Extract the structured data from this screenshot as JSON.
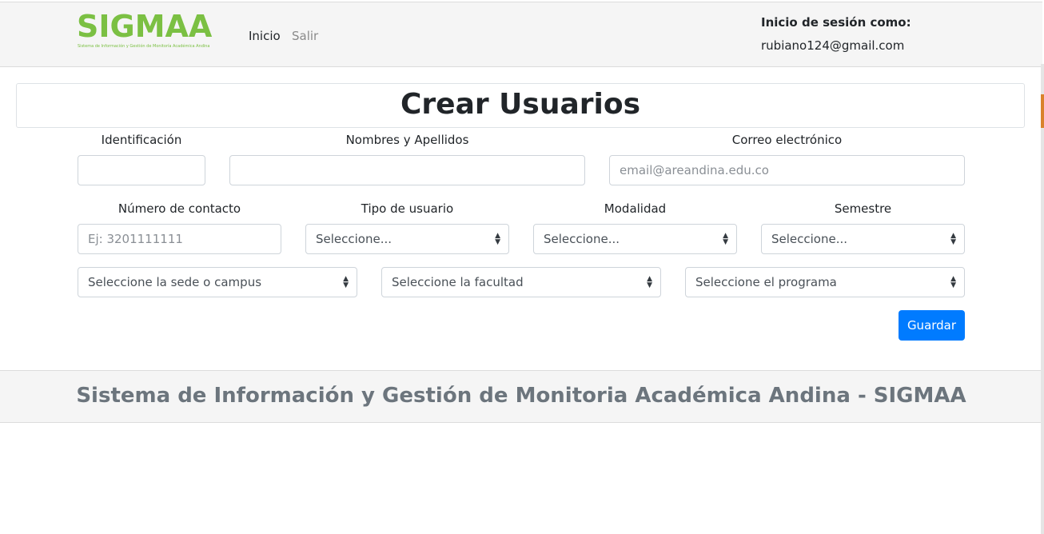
{
  "header": {
    "logo_text": "SIGMAA",
    "logo_tagline": "Sistema de Información y Gestión de Monitoría Académica Andina",
    "nav": {
      "inicio": "Inicio",
      "salir": "Salir"
    },
    "session_label": "Inicio de sesión como:",
    "session_email": "rubiano124@gmail.com"
  },
  "page": {
    "title": "Crear Usuarios"
  },
  "form": {
    "identificacion": {
      "label": "Identificación",
      "value": "",
      "placeholder": ""
    },
    "nombres": {
      "label": "Nombres y Apellidos",
      "value": "",
      "placeholder": ""
    },
    "correo": {
      "label": "Correo electrónico",
      "value": "",
      "placeholder": "email@areandina.edu.co"
    },
    "contacto": {
      "label": "Número de contacto",
      "value": "",
      "placeholder": "Ej: 3201111111"
    },
    "tipo_usuario": {
      "label": "Tipo de usuario",
      "selected": "Seleccione..."
    },
    "modalidad": {
      "label": "Modalidad",
      "selected": "Seleccione..."
    },
    "semestre": {
      "label": "Semestre",
      "selected": "Seleccione..."
    },
    "sede": {
      "selected": "Seleccione la sede o campus"
    },
    "facultad": {
      "selected": "Seleccione la facultad"
    },
    "programa": {
      "selected": "Seleccione el programa"
    },
    "save_label": "Guardar"
  },
  "footer": {
    "text": "Sistema de Información y Gestión de Monitoria Académica Andina - SIGMAA"
  },
  "colors": {
    "brand_green": "#7bc043",
    "primary_button": "#007bff",
    "footer_text": "#6c757d"
  },
  "icons": {
    "select_arrows": "updown-caret-icon"
  }
}
